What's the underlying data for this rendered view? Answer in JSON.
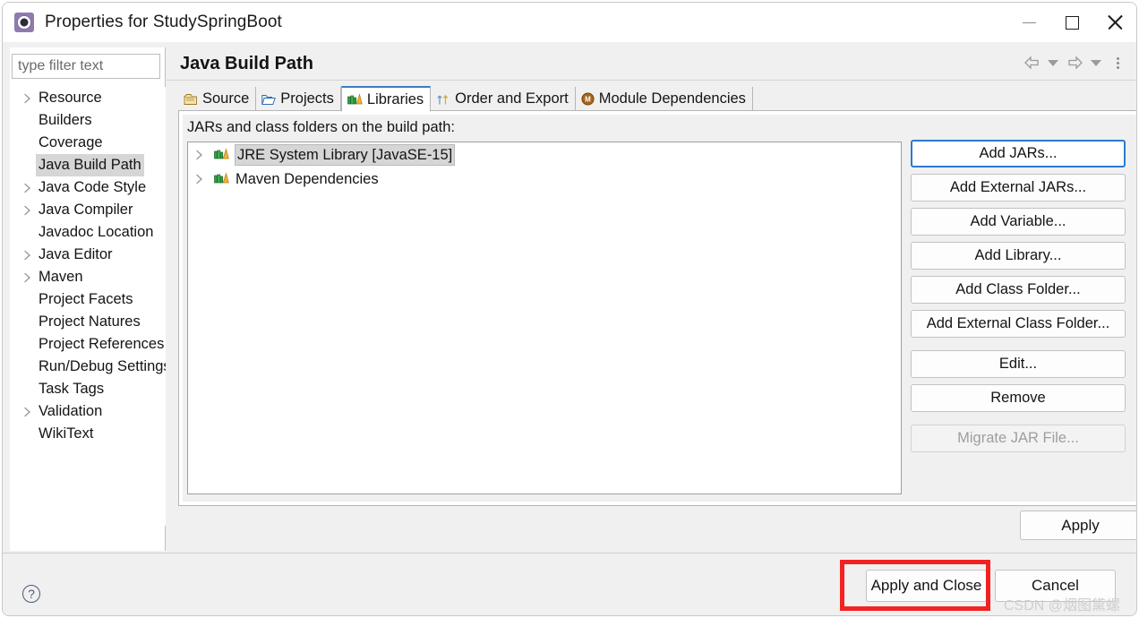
{
  "window": {
    "title": "Properties for StudySpringBoot",
    "icon": "gear-icon",
    "minimize_label": "Minimize",
    "maximize_label": "Maximize",
    "close_label": "Close"
  },
  "sidebar": {
    "filter_placeholder": "type filter text",
    "items": [
      {
        "label": "Resource",
        "expandable": true,
        "selected": false
      },
      {
        "label": "Builders",
        "expandable": false,
        "selected": false
      },
      {
        "label": "Coverage",
        "expandable": false,
        "selected": false
      },
      {
        "label": "Java Build Path",
        "expandable": false,
        "selected": true
      },
      {
        "label": "Java Code Style",
        "expandable": true,
        "selected": false
      },
      {
        "label": "Java Compiler",
        "expandable": true,
        "selected": false
      },
      {
        "label": "Javadoc Location",
        "expandable": false,
        "selected": false
      },
      {
        "label": "Java Editor",
        "expandable": true,
        "selected": false
      },
      {
        "label": "Maven",
        "expandable": true,
        "selected": false
      },
      {
        "label": "Project Facets",
        "expandable": false,
        "selected": false
      },
      {
        "label": "Project Natures",
        "expandable": false,
        "selected": false
      },
      {
        "label": "Project References",
        "expandable": false,
        "selected": false
      },
      {
        "label": "Run/Debug Settings",
        "expandable": false,
        "selected": false
      },
      {
        "label": "Task Tags",
        "expandable": false,
        "selected": false
      },
      {
        "label": "Validation",
        "expandable": true,
        "selected": false
      },
      {
        "label": "WikiText",
        "expandable": false,
        "selected": false
      }
    ]
  },
  "page": {
    "title": "Java Build Path",
    "toolbar": [
      {
        "name": "back-arrow-icon",
        "label": "Back"
      },
      {
        "name": "chevron-down-icon",
        "label": "Back history"
      },
      {
        "name": "forward-arrow-icon",
        "label": "Forward"
      },
      {
        "name": "chevron-down-icon",
        "label": "Forward history"
      },
      {
        "name": "more-menu-icon",
        "label": "View menu"
      }
    ]
  },
  "tabs": [
    {
      "label": "Source",
      "icon": "package-icon",
      "active": false
    },
    {
      "label": "Projects",
      "icon": "folder-icon",
      "active": false
    },
    {
      "label": "Libraries",
      "icon": "books-icon",
      "active": true
    },
    {
      "label": "Order and Export",
      "icon": "order-arrows-icon",
      "active": false
    },
    {
      "label": "Module Dependencies",
      "icon": "module-icon",
      "active": false
    }
  ],
  "libraries_tab": {
    "caption": "JARs and class folders on the build path:",
    "entries": [
      {
        "label": "JRE System Library [JavaSE-15]",
        "icon": "books-icon",
        "expandable": true,
        "selected": true
      },
      {
        "label": "Maven Dependencies",
        "icon": "books-icon",
        "expandable": true,
        "selected": false
      }
    ],
    "buttons": [
      {
        "label": "Add JARs...",
        "state": "focused"
      },
      {
        "label": "Add External JARs...",
        "state": "normal"
      },
      {
        "label": "Add Variable...",
        "state": "normal"
      },
      {
        "label": "Add Library...",
        "state": "normal"
      },
      {
        "label": "Add Class Folder...",
        "state": "normal"
      },
      {
        "label": "Add External Class Folder...",
        "state": "normal"
      },
      {
        "label": "Edit...",
        "state": "normal",
        "group_gap": true
      },
      {
        "label": "Remove",
        "state": "normal"
      },
      {
        "label": "Migrate JAR File...",
        "state": "disabled",
        "group_gap": true
      }
    ],
    "apply_label": "Apply"
  },
  "footer": {
    "help_label": "?",
    "apply_and_close_label": "Apply and Close",
    "cancel_label": "Cancel"
  },
  "annotation": {
    "highlight_target": "Apply and Close",
    "highlight_color": "#f22222"
  },
  "watermark": {
    "text": "CSDN @烟图黛螺"
  }
}
